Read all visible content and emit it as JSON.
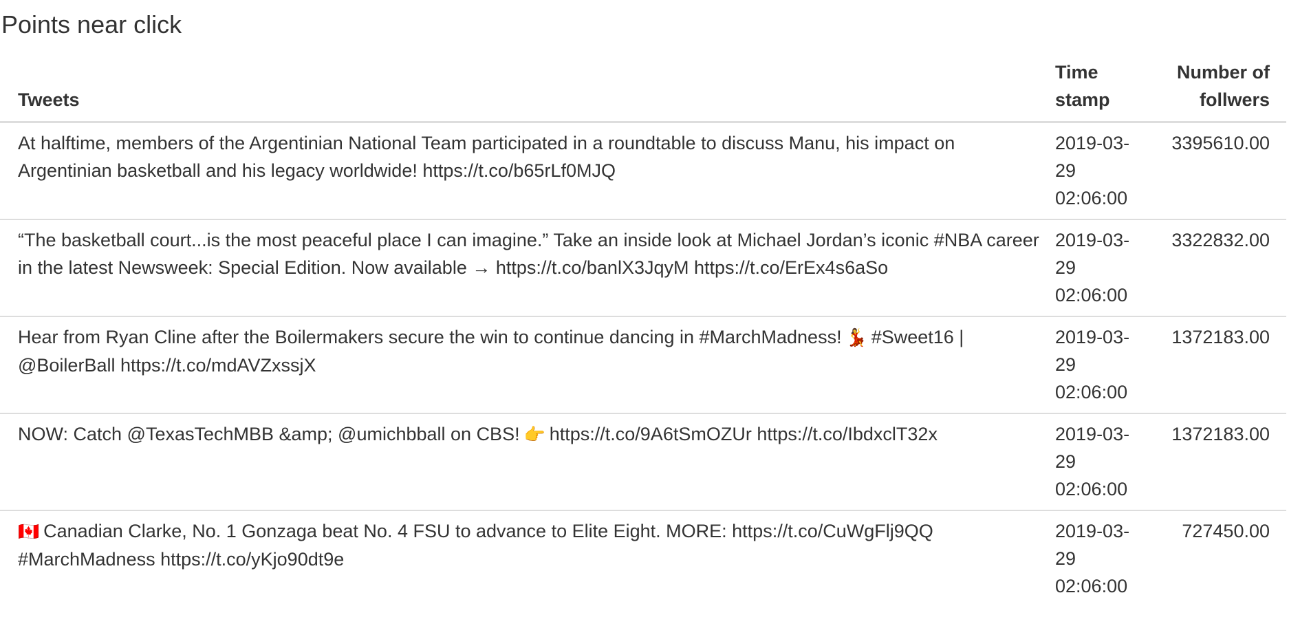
{
  "page": {
    "title": "Points near click"
  },
  "table": {
    "headers": {
      "tweets": "Tweets",
      "time_stamp": "Time stamp",
      "followers": "Number of follwers"
    },
    "rows": [
      {
        "tweet": "At halftime, members of the Argentinian National Team participated in a roundtable to discuss Manu, his impact on Argentinian basketball and his legacy worldwide! https://t.co/b65rLf0MJQ",
        "time_stamp": "2019-03-29 02:06:00",
        "followers": "3395610.00"
      },
      {
        "tweet": "“The basketball court...is the most peaceful place I can imagine.” Take an inside look at Michael Jordan’s iconic #NBA career in the latest Newsweek: Special Edition. Now available → https://t.co/banlX3JqyM https://t.co/ErEx4s6aSo",
        "time_stamp": "2019-03-29 02:06:00",
        "followers": "3322832.00"
      },
      {
        "tweet_before_emoji": "Hear from Ryan Cline after the Boilermakers secure the win to continue dancing in #MarchMadness!",
        "emoji": "💃",
        "tweet_after_emoji": "#Sweet16 | @BoilerBall https://t.co/mdAVZxssjX",
        "time_stamp": "2019-03-29 02:06:00",
        "followers": "1372183.00"
      },
      {
        "tweet_before_emoji": "NOW: Catch @TexasTechMBB &amp; @umichbball on CBS!",
        "emoji": "👉",
        "tweet_after_emoji": "https://t.co/9A6tSmOZUr https://t.co/IbdxclT32x",
        "time_stamp": "2019-03-29 02:06:00",
        "followers": "1372183.00"
      },
      {
        "emoji": "🇨🇦",
        "tweet_after_emoji": "Canadian Clarke, No. 1 Gonzaga beat No. 4 FSU to advance to Elite Eight. MORE: https://t.co/CuWgFlj9QQ #MarchMadness https://t.co/yKjo90dt9e",
        "time_stamp": "2019-03-29 02:06:00",
        "followers": "727450.00"
      }
    ]
  }
}
